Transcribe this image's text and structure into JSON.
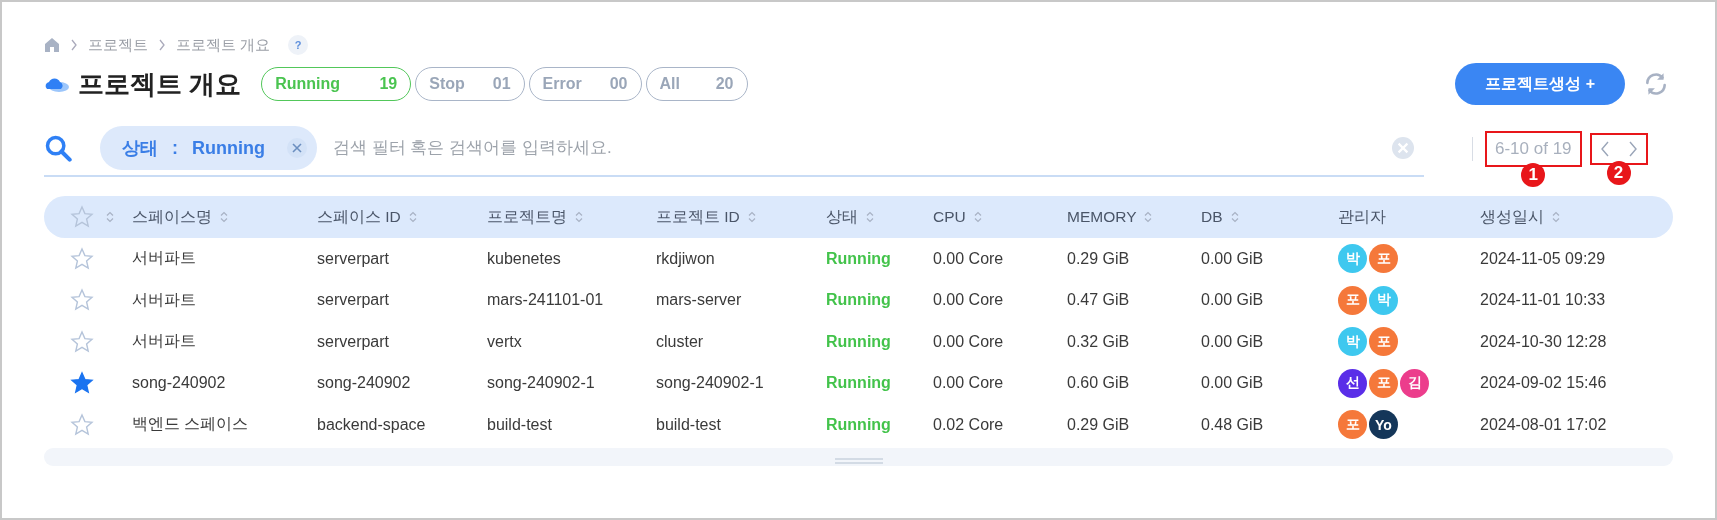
{
  "breadcrumb": [
    "프로젝트",
    "프로젝트 개요"
  ],
  "help": "?",
  "title": "프로젝트 개요",
  "status_filters": [
    {
      "label": "Running",
      "count": "19",
      "selected": true
    },
    {
      "label": "Stop",
      "count": "01",
      "selected": false
    },
    {
      "label": "Error",
      "count": "00",
      "selected": false
    },
    {
      "label": "All",
      "count": "20",
      "selected": false
    }
  ],
  "create_button": "프로젝트생성 +",
  "search": {
    "chip_key": "상태",
    "chip_sep": ":",
    "chip_value": "Running",
    "placeholder": "검색 필터 혹은 검색어를 입력하세요."
  },
  "pagination": {
    "range": "6-10 of 19"
  },
  "annotations": [
    {
      "label": "1"
    },
    {
      "label": "2"
    }
  ],
  "table": {
    "columns": [
      {
        "label": "스페이스명",
        "kind": "sortable"
      },
      {
        "label": "스페이스 ID",
        "kind": "sortable"
      },
      {
        "label": "프로젝트명",
        "kind": "sortable"
      },
      {
        "label": "프로젝트 ID",
        "kind": "sortable"
      },
      {
        "label": "상태",
        "kind": "sortable"
      },
      {
        "label": "CPU",
        "kind": "sortable"
      },
      {
        "label": "MEMORY",
        "kind": "sortable"
      },
      {
        "label": "DB",
        "kind": "sortable"
      },
      {
        "label": "관리자",
        "kind": "plain"
      },
      {
        "label": "생성일시",
        "kind": "sortable"
      }
    ],
    "rows": [
      {
        "starred": false,
        "space": "서버파트",
        "space_id": "serverpart",
        "project": "kubenetes",
        "project_id": "rkdjiwon",
        "status": "Running",
        "cpu": "0.00 Core",
        "memory": "0.29 GiB",
        "db": "0.00 GiB",
        "managers": [
          {
            "label": "박",
            "color": "#3ec8ef"
          },
          {
            "label": "포",
            "color": "#f5783a"
          }
        ],
        "created": "2024-11-05 09:29"
      },
      {
        "starred": false,
        "space": "서버파트",
        "space_id": "serverpart",
        "project": "mars-241101-01",
        "project_id": "mars-server",
        "status": "Running",
        "cpu": "0.00 Core",
        "memory": "0.47 GiB",
        "db": "0.00 GiB",
        "managers": [
          {
            "label": "포",
            "color": "#f5783a"
          },
          {
            "label": "박",
            "color": "#3ec8ef"
          }
        ],
        "created": "2024-11-01 10:33"
      },
      {
        "starred": false,
        "space": "서버파트",
        "space_id": "serverpart",
        "project": "vertx",
        "project_id": "cluster",
        "status": "Running",
        "cpu": "0.00 Core",
        "memory": "0.32 GiB",
        "db": "0.00 GiB",
        "managers": [
          {
            "label": "박",
            "color": "#3ec8ef"
          },
          {
            "label": "포",
            "color": "#f5783a"
          }
        ],
        "created": "2024-10-30 12:28"
      },
      {
        "starred": true,
        "space": "song-240902",
        "space_id": "song-240902",
        "project": "song-240902-1",
        "project_id": "song-240902-1",
        "status": "Running",
        "cpu": "0.00 Core",
        "memory": "0.60 GiB",
        "db": "0.00 GiB",
        "managers": [
          {
            "label": "선",
            "color": "#5a2ee8"
          },
          {
            "label": "포",
            "color": "#f5783a"
          },
          {
            "label": "김",
            "color": "#ec3d8c"
          }
        ],
        "created": "2024-09-02 15:46"
      },
      {
        "starred": false,
        "space": "백엔드 스페이스",
        "space_id": "backend-space",
        "project": "build-test",
        "project_id": "build-test",
        "status": "Running",
        "cpu": "0.02 Core",
        "memory": "0.29 GiB",
        "db": "0.48 GiB",
        "managers": [
          {
            "label": "포",
            "color": "#f5783a"
          },
          {
            "label": "Yo",
            "color": "#143659"
          }
        ],
        "created": "2024-08-01 17:02"
      }
    ]
  }
}
